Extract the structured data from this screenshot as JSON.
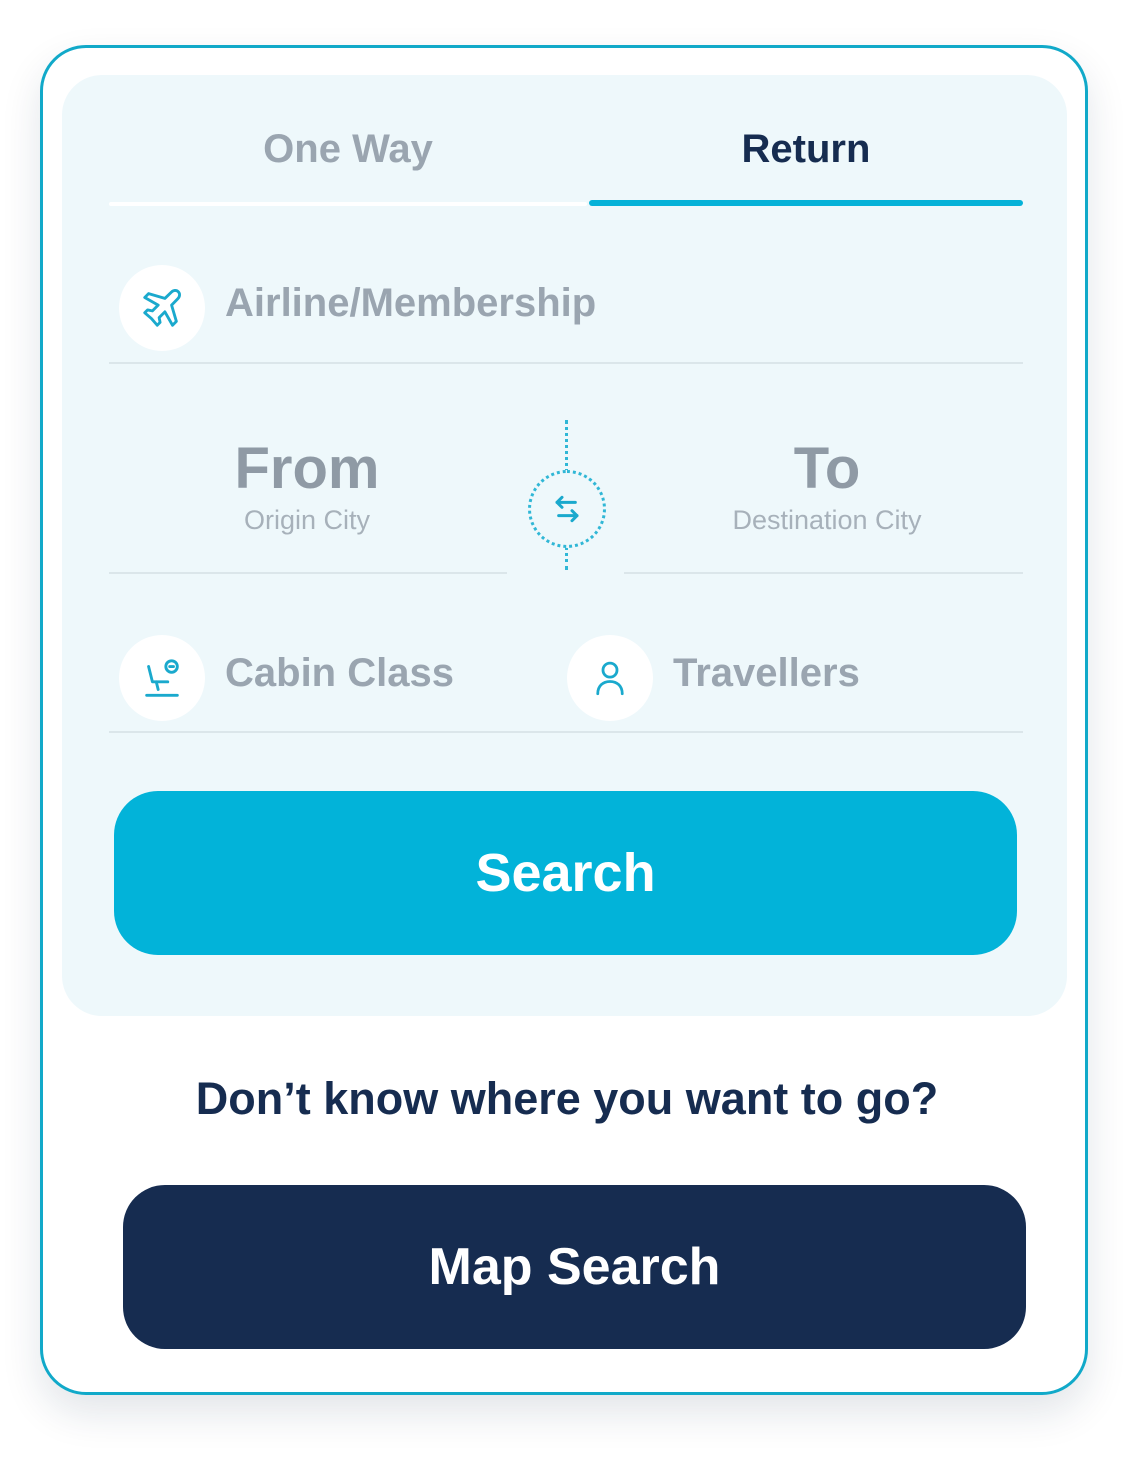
{
  "tabs": [
    {
      "label": "One Way",
      "active": false
    },
    {
      "label": "Return",
      "active": true
    }
  ],
  "airline": {
    "label": "Airline/Membership",
    "icon": "airplane-icon"
  },
  "origin": {
    "label": "From",
    "sublabel": "Origin City"
  },
  "destination": {
    "label": "To",
    "sublabel": "Destination City"
  },
  "swap": {
    "icon": "swap-arrows-icon"
  },
  "cabin": {
    "label": "Cabin Class",
    "icon": "seat-icon"
  },
  "travellers": {
    "label": "Travellers",
    "icon": "person-icon"
  },
  "search_button": {
    "label": "Search"
  },
  "prompt": {
    "text": "Don’t know where you want to go?"
  },
  "map_search_button": {
    "label": "Map Search"
  },
  "colors": {
    "accent": "#02b3d9",
    "navy": "#162c50",
    "panel": "#eef8fb",
    "muted_text": "#9aa5b0"
  }
}
